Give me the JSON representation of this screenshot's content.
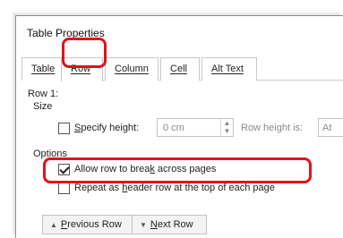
{
  "dialog": {
    "title": "Table Properties"
  },
  "tabs": [
    {
      "label_pre": "",
      "label_u": "T",
      "label_post": "able"
    },
    {
      "label_pre": "",
      "label_u": "R",
      "label_post": "ow"
    },
    {
      "label_pre": "Col",
      "label_u": "u",
      "label_post": "mn"
    },
    {
      "label_pre": "C",
      "label_u": "e",
      "label_post": "ll"
    },
    {
      "label_pre": "",
      "label_u": "A",
      "label_post": "lt Text"
    }
  ],
  "active_tab": "Row",
  "row_section": {
    "heading": "Row 1:",
    "size_label": "Size",
    "specify_height": {
      "pre": "",
      "u": "S",
      "post": "pecify height:",
      "checked": false
    },
    "height_value": "0 cm",
    "row_height_is_label": "Row height is:",
    "row_height_is_value": "At"
  },
  "options": {
    "label": "Options",
    "allow_break": {
      "pre": "Allow row to brea",
      "u": "k",
      "post": " across pages",
      "checked": true
    },
    "repeat_header": {
      "pre": "Repeat as ",
      "u": "h",
      "post": "eader row at the top of each page",
      "checked": false
    }
  },
  "buttons": {
    "previous": {
      "u": "P",
      "post": "revious Row",
      "icon": "up-triangle-icon"
    },
    "next": {
      "u": "N",
      "post": "ext Row",
      "icon": "down-triangle-icon"
    }
  },
  "colors": {
    "highlight": "#e0141a"
  }
}
